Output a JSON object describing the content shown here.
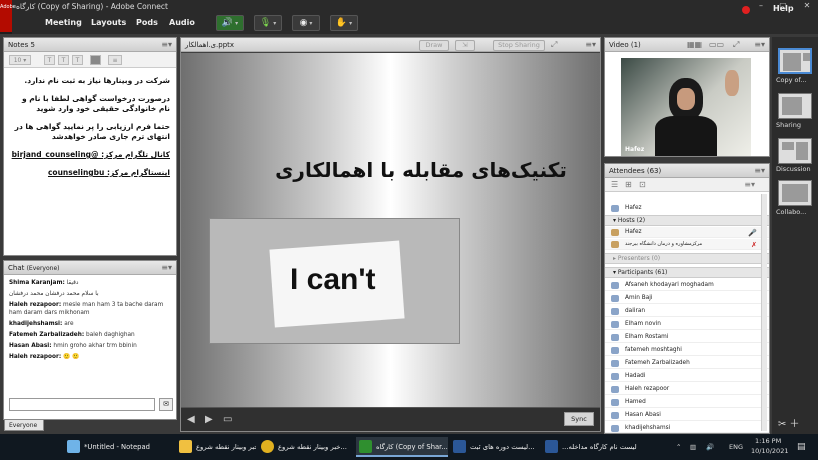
{
  "window": {
    "title": "کارگاه (Copy of Sharing) - Adobe Connect",
    "logo": "Adobe",
    "controls": [
      "–",
      "▢",
      "✕"
    ]
  },
  "menu": {
    "items": [
      "Meeting",
      "Layouts",
      "Pods",
      "Audio"
    ],
    "help": "Help"
  },
  "toolbar": {
    "speaker_icon": "speaker-icon",
    "mic_icon": "mic-icon",
    "camera_icon": "webcam-icon",
    "status_icon": "raise-hand-icon"
  },
  "notes": {
    "header": "Notes 5",
    "font_size": "10",
    "lines": [
      "شرکت در وبینارها نیاز به ثبت نام ندارد.",
      "درصورت درخواست گواهی لطفا با نام و نام خانوادگی حقیقی خود وارد شوید",
      "حتما فرم ارزیابی را پر نمایید گواهی ها در انتهای ترم جاری صادر خواهدشد",
      "کانال تلگرام مرکز: @birjand_counseling",
      "اینستاگرام مرکز: counselingbu"
    ]
  },
  "chat": {
    "header": "Chat",
    "scope": "(Everyone)",
    "tab": "Everyone",
    "messages": [
      {
        "name": "Shima Karanjam:",
        "text": "دقیقا"
      },
      {
        "name": "",
        "text": "با سلام محمد درفشان محمد درفشان"
      },
      {
        "name": "Haleh rezapoor:",
        "text": "mesle man ham 3 ta bache daram ham daram dars mikhonam"
      },
      {
        "name": "khadijehshamsi:",
        "text": "are"
      },
      {
        "name": "Fatemeh Zarbalizadeh:",
        "text": "baleh daghighan"
      },
      {
        "name": "Hasan Abasi:",
        "text": "hmin groho akhar trm bbinin"
      },
      {
        "name": "Haleh rezapoor:",
        "text": "🙂 🙂"
      }
    ]
  },
  "share": {
    "header": "ی.اهمالکار.pptx",
    "draw_label": "Draw",
    "stop_label": "Stop Sharing",
    "sync_label": "Sync",
    "slide_title": "تکنیک‌های مقابله با اهمالکاری",
    "image_text": "I can't"
  },
  "video": {
    "header": "Video",
    "count": "(1)",
    "participant": "Hafez"
  },
  "attendees": {
    "header": "Attendees",
    "count": "(63)",
    "current_user": "Hafez",
    "hosts_label": "Hosts (2)",
    "hosts": [
      "Hafez",
      "مرکزمشاوره و درمان دانشگاه بیرجند"
    ],
    "presenters_label": "Presenters (0)",
    "participants_label": "Participants (61)",
    "participants": [
      "Afsaneh khodayari moghadam",
      "Amin Baji",
      "daliran",
      "Elham novin",
      "Elham Rostami",
      "fatemeh moshtaghi",
      "Fatemeh Zarbalizadeh",
      "Hadadi",
      "Haleh rezapoor",
      "Hamed",
      "Hasan Abasi",
      "khadijehshamsi"
    ]
  },
  "layouts": {
    "items": [
      "Copy of...",
      "Sharing",
      "Discussion",
      "Collabo..."
    ]
  },
  "taskbar": {
    "items": [
      "*Untitled - Notepad",
      "خبر وبینار نقطه شروع",
      "خبر وبینار نقطه شروع...",
      "کارگاه (Copy of Shar...",
      "لیست دوره های ثبت...",
      "...لیست نام کارگاه مداخله"
    ],
    "lang": "ENG",
    "time": "1:16 PM",
    "date": "10/10/2021"
  },
  "colors": {
    "accent": "#4a8ad4",
    "record": "#e02020",
    "adobe": "#b30b00"
  }
}
